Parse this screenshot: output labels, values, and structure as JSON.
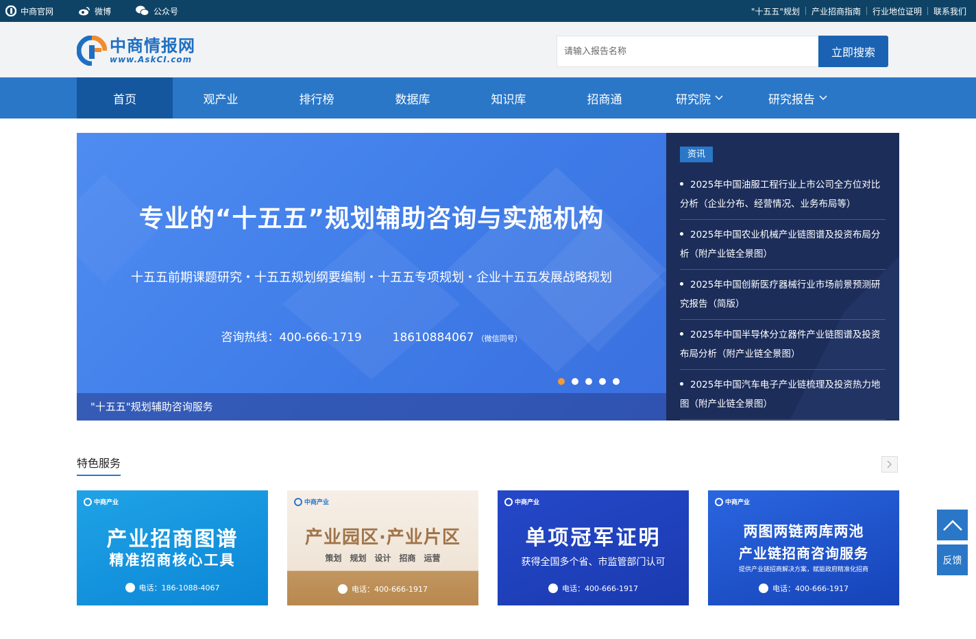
{
  "topbar": {
    "left": [
      {
        "icon": "zhongshang-logo-icon",
        "label": "中商官网"
      },
      {
        "icon": "weibo-icon",
        "label": "微博"
      },
      {
        "icon": "wechat-icon",
        "label": "公众号"
      }
    ],
    "right": [
      "\"十五五\"规划",
      "产业招商指南",
      "行业地位证明",
      "联系我们"
    ]
  },
  "header": {
    "logo_cn": "中商情报网",
    "logo_en": "www.AskCI.com",
    "search_placeholder": "请输入报告名称",
    "search_button": "立即搜索"
  },
  "nav": {
    "items": [
      {
        "label": "首页",
        "active": true,
        "dropdown": false
      },
      {
        "label": "观产业",
        "active": false,
        "dropdown": false
      },
      {
        "label": "排行榜",
        "active": false,
        "dropdown": false
      },
      {
        "label": "数据库",
        "active": false,
        "dropdown": false
      },
      {
        "label": "知识库",
        "active": false,
        "dropdown": false
      },
      {
        "label": "招商通",
        "active": false,
        "dropdown": false
      },
      {
        "label": "研究院",
        "active": false,
        "dropdown": true
      },
      {
        "label": "研究报告",
        "active": false,
        "dropdown": true
      }
    ]
  },
  "banner": {
    "title": "专业的“十五五”规划辅助咨询与实施机构",
    "subtitle": "十五五前期课题研究・十五五规划纲要编制・十五五专项规划・企业十五五发展战略规划",
    "hotline_label": "咨询热线：400-666-1719",
    "mobile": "18610884067",
    "mobile_note": "（微信同号）",
    "caption": "\"十五五\"规划辅助咨询服务",
    "dots_count": 5,
    "active_dot": 0
  },
  "news": {
    "tag": "资讯",
    "items": [
      "2025年中国油服工程行业上市公司全方位对比分析（企业分布、经营情况、业务布局等）",
      "2025年中国农业机械产业链图谱及投资布局分析（附产业链全景图）",
      "2025年中国创新医疗器械行业市场前景预测研究报告（简版）",
      "2025年中国半导体分立器件产业链图谱及投资布局分析（附产业链全景图）",
      "2025年中国汽车电子产业链梳理及投资热力地图（附产业链全景图）"
    ]
  },
  "services": {
    "title": "特色服务",
    "cards": [
      {
        "brand": "中商产业",
        "title": "产业招商图谱",
        "subtitle": "精准招商核心工具",
        "phone": "电话：186-1088-4067"
      },
      {
        "brand": "中商产业",
        "title": "产业园区·产业片区",
        "subtitle": "策划　规划　设计　招商　运营",
        "phone": "电话：400-666-1917"
      },
      {
        "brand": "中商产业",
        "title": "单项冠军证明",
        "subtitle": "获得全国多个省、市监管部门认可",
        "phone": "电话：400-666-1917"
      },
      {
        "brand": "中商产业",
        "title": "两图两链两库两池",
        "title2": "产业链招商咨询服务",
        "subtitle": "提供产业链招商解决方案，赋能政府精准化招商",
        "phone": "电话：400-666-1917"
      }
    ]
  },
  "float": {
    "feedback": "反馈"
  },
  "colors": {
    "topbar": "#0e4366",
    "nav": "#2a77c8",
    "nav_active": "#15579f",
    "news_bg": "#1c2d5a",
    "accent_orange": "#f39a3b"
  }
}
